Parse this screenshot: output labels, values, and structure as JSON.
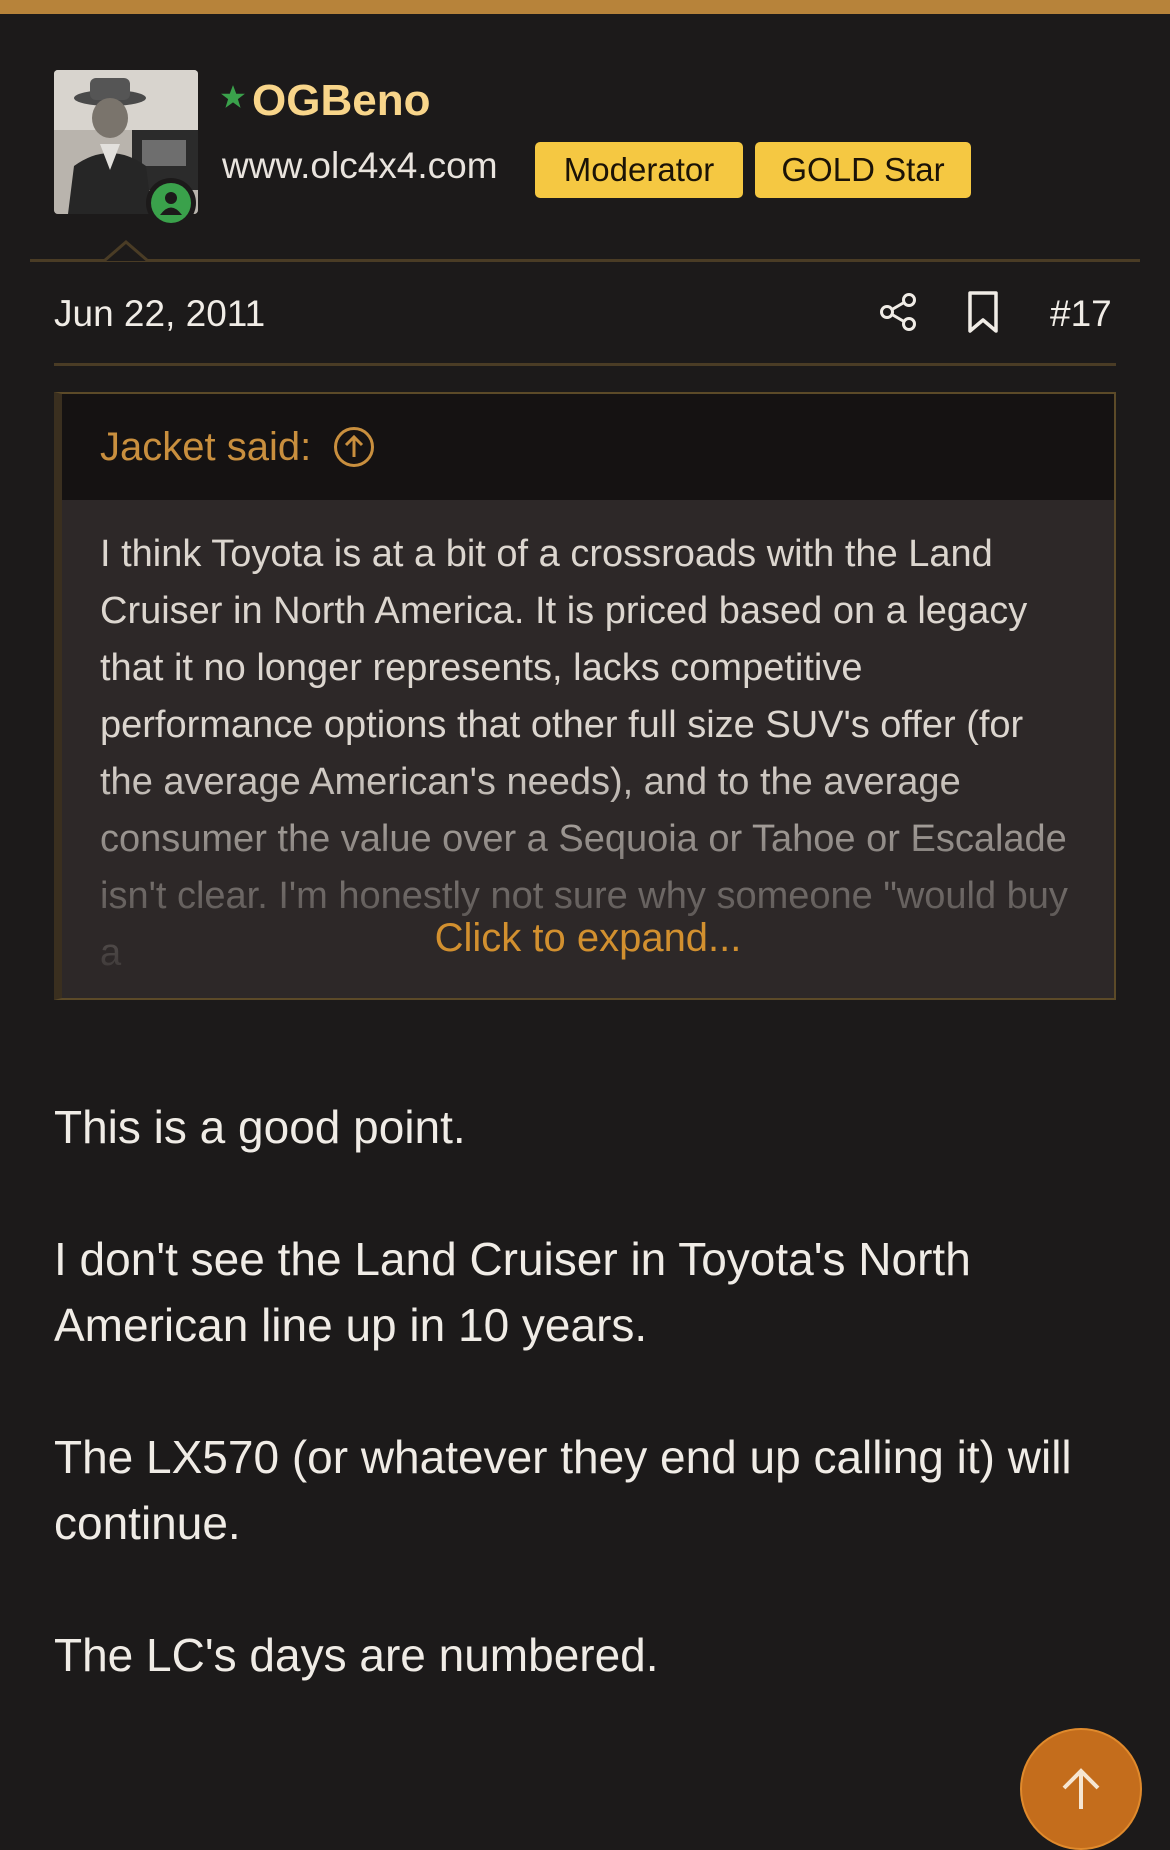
{
  "user": {
    "name": "OGBeno",
    "site": "www.olc4x4.com",
    "badges": [
      "Moderator",
      "GOLD Star"
    ]
  },
  "post_meta": {
    "date": "Jun 22, 2011",
    "number": "#17"
  },
  "quote": {
    "author": "Jacket said:",
    "text": "I think Toyota is at a bit of a crossroads with the Land Cruiser in North America. It is priced based on a legacy that it no longer represents, lacks competitive performance options that other full size SUV's offer (for the average American's needs), and to the average consumer the value over a Sequoia or Tahoe or Escalade isn't clear. I'm honestly not sure why someone \"would buy a",
    "expand_label": "Click to expand..."
  },
  "body": {
    "paragraphs": [
      "This is a good point.",
      "I don't see the Land Cruiser in Toyota's North American line up in 10 years.",
      "The LX570 (or whatever they end up calling it) will continue.",
      "The LC's days are numbered."
    ]
  },
  "colors": {
    "accent": "#b7833a",
    "username": "#f8d58a",
    "badge": "#f5c842",
    "link": "#d2902f",
    "scroll_button": "#c46d1c"
  }
}
